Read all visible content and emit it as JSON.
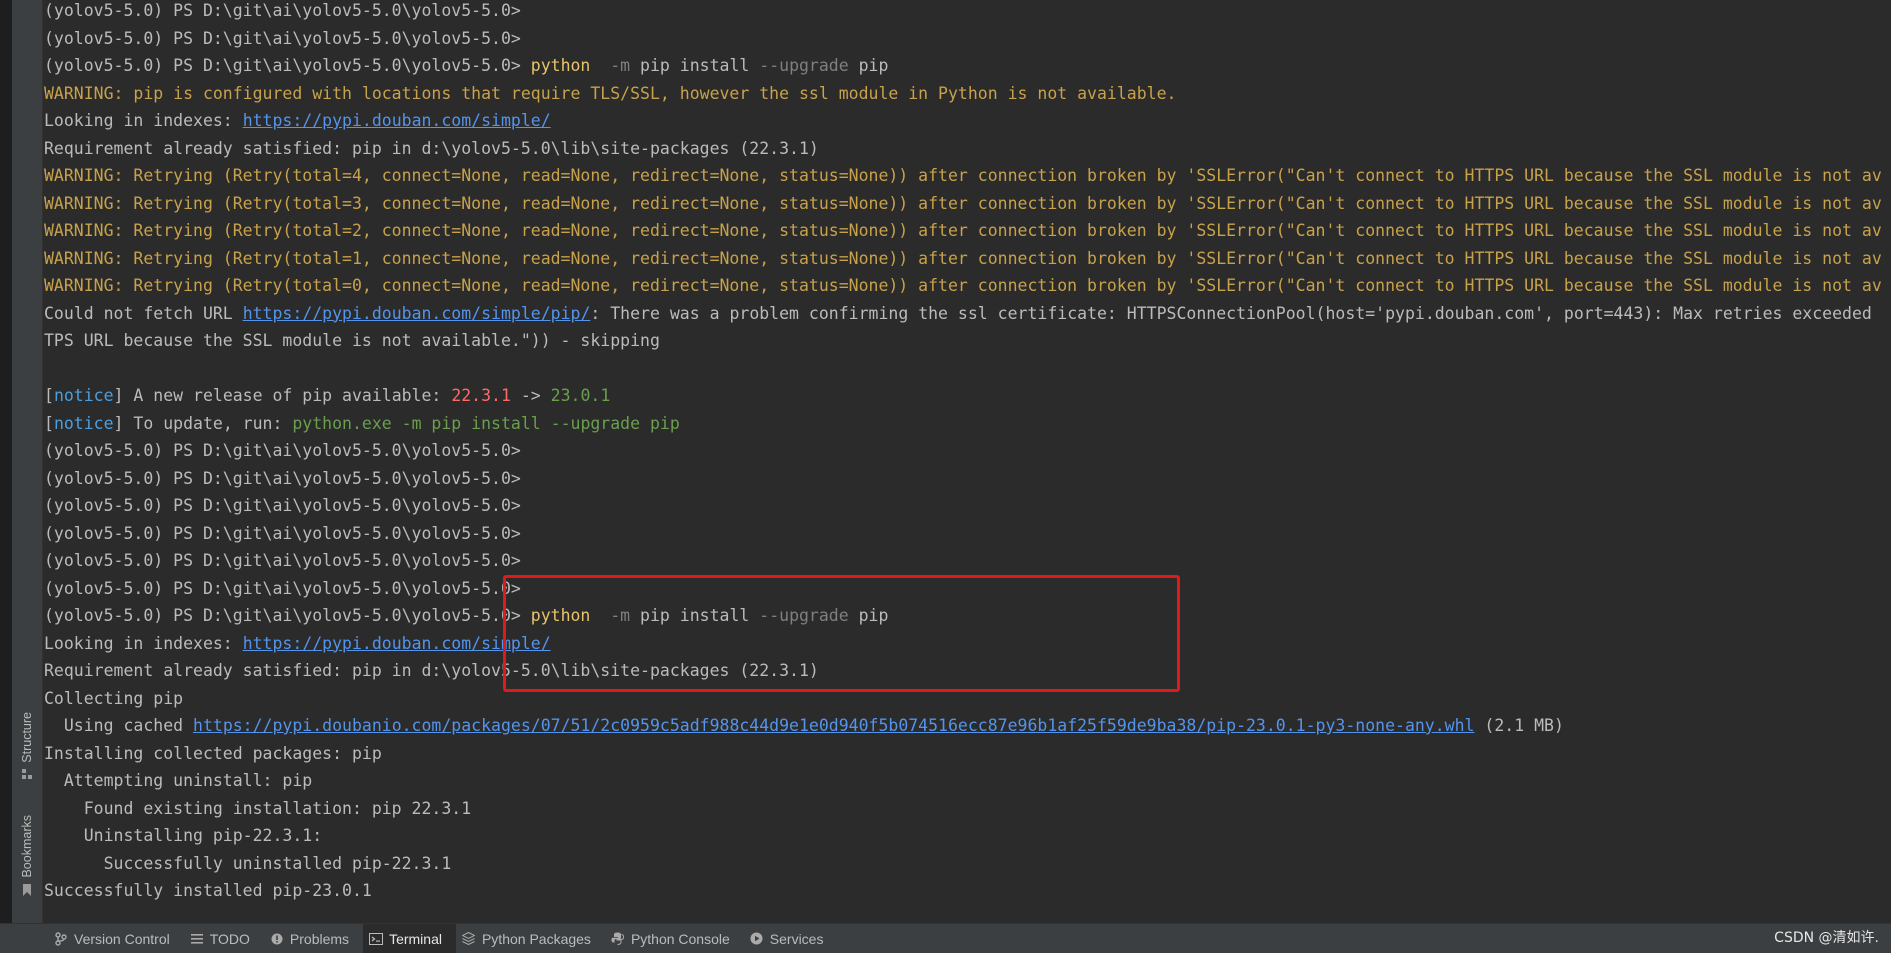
{
  "sidebar": {
    "structure_label": "Structure",
    "bookmarks_label": "Bookmarks"
  },
  "terminal": {
    "lines": [
      [
        {
          "t": "(yolov5-5.0) PS D:\\git\\ai\\yolov5-5.0\\yolov5-5.0>",
          "c": "prompt"
        }
      ],
      [
        {
          "t": "(yolov5-5.0) PS D:\\git\\ai\\yolov5-5.0\\yolov5-5.0>",
          "c": "prompt"
        }
      ],
      [
        {
          "t": "(yolov5-5.0) PS D:\\git\\ai\\yolov5-5.0\\yolov5-5.0> ",
          "c": "prompt"
        },
        {
          "t": "python",
          "c": "cmd"
        },
        {
          "t": "  -m ",
          "c": "flag"
        },
        {
          "t": "pip install ",
          "c": "plain"
        },
        {
          "t": "--upgrade ",
          "c": "flag"
        },
        {
          "t": "pip",
          "c": "plain"
        }
      ],
      [
        {
          "t": "WARNING: pip is configured with locations that require TLS/SSL, however the ssl module in Python is not available.",
          "c": "warn"
        }
      ],
      [
        {
          "t": "Looking in indexes: ",
          "c": "plain"
        },
        {
          "t": "https://pypi.douban.com/simple/",
          "c": "link"
        }
      ],
      [
        {
          "t": "Requirement already satisfied: pip in d:\\yolov5-5.0\\lib\\site-packages (22.3.1)",
          "c": "plain"
        }
      ],
      [
        {
          "t": "WARNING: Retrying (Retry(total=4, connect=None, read=None, redirect=None, status=None)) after connection broken by 'SSLError(\"Can't connect to HTTPS URL because the SSL module is not av",
          "c": "warn"
        }
      ],
      [
        {
          "t": "WARNING: Retrying (Retry(total=3, connect=None, read=None, redirect=None, status=None)) after connection broken by 'SSLError(\"Can't connect to HTTPS URL because the SSL module is not av",
          "c": "warn"
        }
      ],
      [
        {
          "t": "WARNING: Retrying (Retry(total=2, connect=None, read=None, redirect=None, status=None)) after connection broken by 'SSLError(\"Can't connect to HTTPS URL because the SSL module is not av",
          "c": "warn"
        }
      ],
      [
        {
          "t": "WARNING: Retrying (Retry(total=1, connect=None, read=None, redirect=None, status=None)) after connection broken by 'SSLError(\"Can't connect to HTTPS URL because the SSL module is not av",
          "c": "warn"
        }
      ],
      [
        {
          "t": "WARNING: Retrying (Retry(total=0, connect=None, read=None, redirect=None, status=None)) after connection broken by 'SSLError(\"Can't connect to HTTPS URL because the SSL module is not av",
          "c": "warn"
        }
      ],
      [
        {
          "t": "Could not fetch URL ",
          "c": "plain"
        },
        {
          "t": "https://pypi.douban.com/simple/pip/",
          "c": "link"
        },
        {
          "t": ": There was a problem confirming the ssl certificate: HTTPSConnectionPool(host='pypi.douban.com', port=443): Max retries exceeded",
          "c": "plain"
        }
      ],
      [
        {
          "t": "TPS URL because the SSL module is not available.\")) - skipping",
          "c": "plain"
        }
      ],
      [
        {
          "t": "",
          "c": "plain"
        }
      ],
      [
        {
          "t": "[",
          "c": "plain"
        },
        {
          "t": "notice",
          "c": "notice"
        },
        {
          "t": "] A new release of pip available: ",
          "c": "plain"
        },
        {
          "t": "22.3.1",
          "c": "err"
        },
        {
          "t": " -> ",
          "c": "plain"
        },
        {
          "t": "23.0.1",
          "c": "ok"
        }
      ],
      [
        {
          "t": "[",
          "c": "plain"
        },
        {
          "t": "notice",
          "c": "notice"
        },
        {
          "t": "] To update, run: ",
          "c": "plain"
        },
        {
          "t": "python.exe -m pip install --upgrade pip",
          "c": "ok"
        }
      ],
      [
        {
          "t": "(yolov5-5.0) PS D:\\git\\ai\\yolov5-5.0\\yolov5-5.0>",
          "c": "prompt"
        }
      ],
      [
        {
          "t": "(yolov5-5.0) PS D:\\git\\ai\\yolov5-5.0\\yolov5-5.0>",
          "c": "prompt"
        }
      ],
      [
        {
          "t": "(yolov5-5.0) PS D:\\git\\ai\\yolov5-5.0\\yolov5-5.0>",
          "c": "prompt"
        }
      ],
      [
        {
          "t": "(yolov5-5.0) PS D:\\git\\ai\\yolov5-5.0\\yolov5-5.0>",
          "c": "prompt"
        }
      ],
      [
        {
          "t": "(yolov5-5.0) PS D:\\git\\ai\\yolov5-5.0\\yolov5-5.0>",
          "c": "prompt"
        }
      ],
      [
        {
          "t": "(yolov5-5.0) PS D:\\git\\ai\\yolov5-5.0\\yolov5-5.0>",
          "c": "prompt"
        }
      ],
      [
        {
          "t": "(yolov5-5.0) PS D:\\git\\ai\\yolov5-5.0\\yolov5-5.0> ",
          "c": "prompt"
        },
        {
          "t": "python",
          "c": "cmd"
        },
        {
          "t": "  -m ",
          "c": "flag"
        },
        {
          "t": "pip install ",
          "c": "plain"
        },
        {
          "t": "--upgrade ",
          "c": "flag"
        },
        {
          "t": "pip",
          "c": "plain"
        }
      ],
      [
        {
          "t": "Looking in indexes: ",
          "c": "plain"
        },
        {
          "t": "https://pypi.douban.com/simple/",
          "c": "link"
        }
      ],
      [
        {
          "t": "Requirement already satisfied: pip in d:\\yolov5-5.0\\lib\\site-packages (22.3.1)",
          "c": "plain"
        }
      ],
      [
        {
          "t": "Collecting pip",
          "c": "plain"
        }
      ],
      [
        {
          "t": "  Using cached ",
          "c": "plain"
        },
        {
          "t": "https://pypi.doubanio.com/packages/07/51/2c0959c5adf988c44d9e1e0d940f5b074516ecc87e96b1af25f59de9ba38/pip-23.0.1-py3-none-any.whl",
          "c": "link"
        },
        {
          "t": " (2.1 MB)",
          "c": "plain"
        }
      ],
      [
        {
          "t": "Installing collected packages: pip",
          "c": "plain"
        }
      ],
      [
        {
          "t": "  Attempting uninstall: pip",
          "c": "plain"
        }
      ],
      [
        {
          "t": "    Found existing installation: pip 22.3.1",
          "c": "plain"
        }
      ],
      [
        {
          "t": "    Uninstalling pip-22.3.1:",
          "c": "plain"
        }
      ],
      [
        {
          "t": "      Successfully uninstalled pip-22.3.1",
          "c": "plain"
        }
      ],
      [
        {
          "t": "Successfully installed pip-23.0.1",
          "c": "plain"
        }
      ]
    ]
  },
  "bottom_tabs": [
    {
      "label": "Version Control",
      "icon": "version-control-icon"
    },
    {
      "label": "TODO",
      "icon": "list-icon"
    },
    {
      "label": "Problems",
      "icon": "problems-icon"
    },
    {
      "label": "Terminal",
      "icon": "terminal-icon",
      "active": true
    },
    {
      "label": "Python Packages",
      "icon": "packages-icon"
    },
    {
      "label": "Python Console",
      "icon": "python-icon"
    },
    {
      "label": "Services",
      "icon": "services-icon"
    }
  ],
  "watermark": "CSDN @清如许.",
  "colors": {
    "background": "#2b2b2b",
    "warning": "#c8a24a",
    "link": "#5394ec",
    "highlight_box": "#e0191b"
  }
}
